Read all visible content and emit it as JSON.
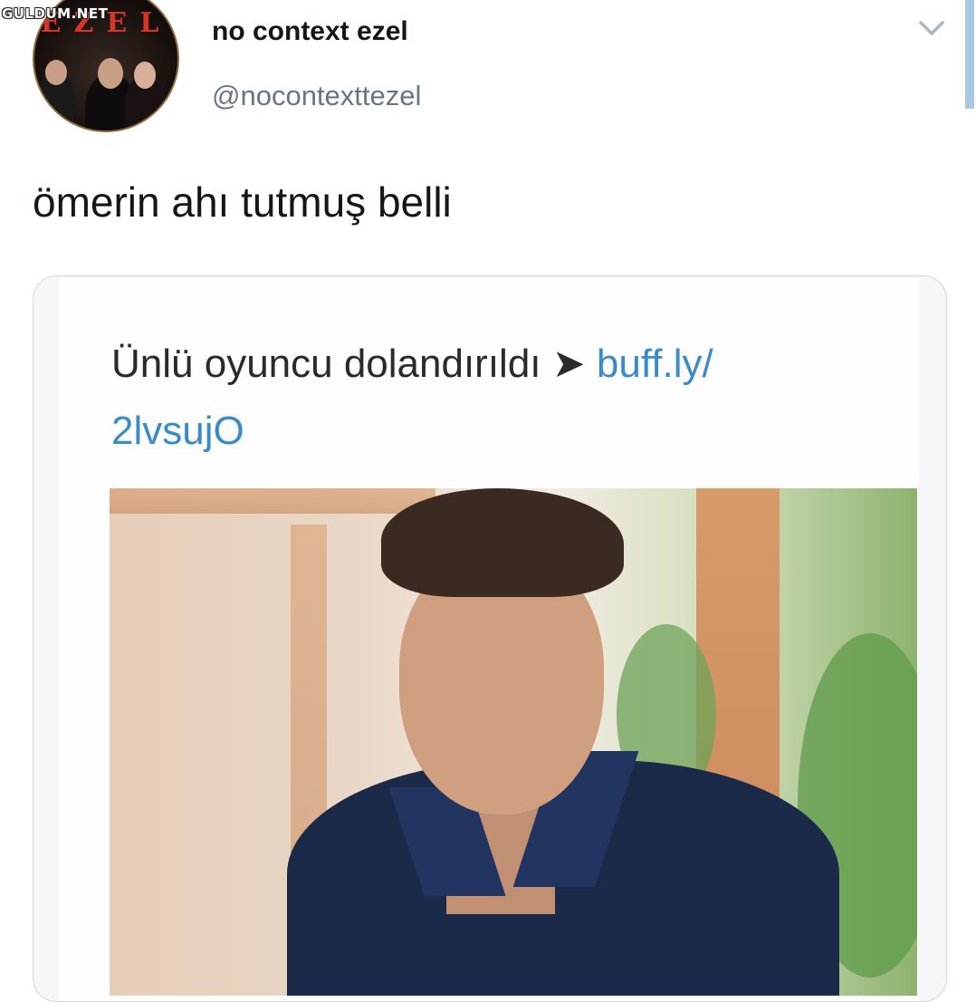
{
  "watermark": "GULDUM.NET",
  "avatar": {
    "logo_text": "EZEL"
  },
  "tweet": {
    "display_name": "no context ezel",
    "handle": "@nocontexttezel",
    "text": "ömerin ahı tutmuş belli"
  },
  "embedded_post": {
    "headline": "Ünlü oyuncu dolandırıldı",
    "arrow": "➤",
    "link_part1": "buff.ly/",
    "link_part2": "2lvsujO"
  },
  "icons": {
    "menu": "chevron-down-icon"
  }
}
